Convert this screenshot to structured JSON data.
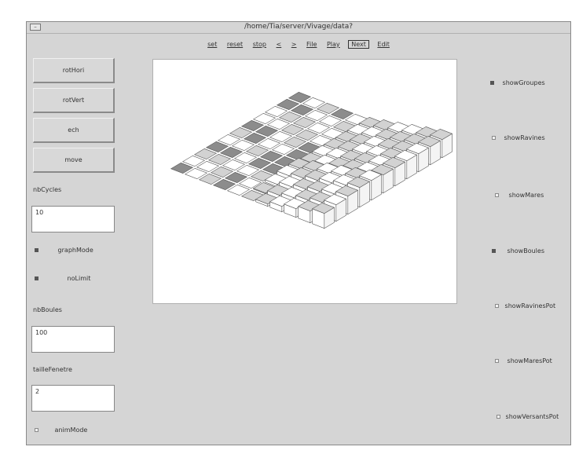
{
  "window": {
    "title": "/home/Tia/server/Vivage/data?",
    "menu_glyph": "–"
  },
  "toolbar": [
    {
      "label": "set",
      "active": false
    },
    {
      "label": "reset",
      "active": false
    },
    {
      "label": "stop",
      "active": false
    },
    {
      "label": "<",
      "active": false
    },
    {
      "label": ">",
      "active": false
    },
    {
      "label": "File",
      "active": false
    },
    {
      "label": "Play",
      "active": false
    },
    {
      "label": "Next",
      "active": true
    },
    {
      "label": "Edit",
      "active": false
    }
  ],
  "left": {
    "buttons": [
      "rotHori",
      "rotVert",
      "ech",
      "move"
    ],
    "nbCycles": {
      "label": "nbCycles",
      "value": "10"
    },
    "graphMode": {
      "label": "graphMode",
      "checked": true
    },
    "noLimit": {
      "label": "noLimit",
      "checked": true
    },
    "nbBoules": {
      "label": "nbBoules",
      "value": "100"
    },
    "tailleFenetre": {
      "label": "tailleFenetre",
      "value": "2"
    },
    "animMode": {
      "label": "animMode",
      "checked": false
    }
  },
  "right": [
    {
      "label": "showGroupes",
      "checked": true
    },
    {
      "label": "showRavines",
      "checked": false
    },
    {
      "label": "showMares",
      "checked": false
    },
    {
      "label": "showBoules",
      "checked": true
    },
    {
      "label": "showRavinesPot",
      "checked": false
    },
    {
      "label": "showMaresPot",
      "checked": false
    },
    {
      "label": "showVersantsPot",
      "checked": false
    }
  ],
  "colors": {
    "tile_dark": "#8c8c8c",
    "tile_light": "#d2d2d2",
    "tile_white": "#ffffff",
    "edge": "#555555"
  }
}
